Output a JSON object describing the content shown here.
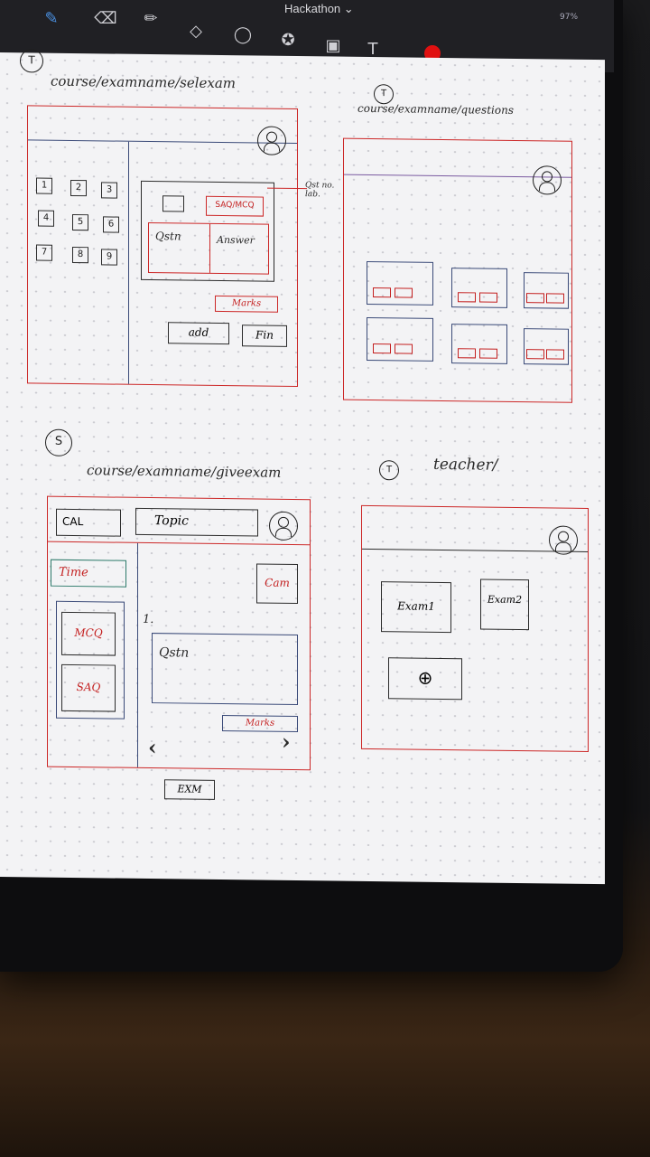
{
  "app": {
    "title": "Hackathon",
    "title_caret": "⌄",
    "status": "97%"
  },
  "toolbar_icons": [
    "pen-icon",
    "eraser-icon",
    "pencil-icon",
    "shapes-icon",
    "lasso-icon",
    "star-icon",
    "image-icon",
    "text-icon",
    "color-red-icon"
  ],
  "sketch1": {
    "badge": "T",
    "path": "course/examname/selexam",
    "numbers": [
      "1",
      "2",
      "3",
      "4",
      "5",
      "6",
      "7",
      "8",
      "9"
    ],
    "type_box": "SAQ/MCQ",
    "question": "Qstn",
    "answer": "Answer",
    "marks": "Marks",
    "add": "add",
    "fin": "Fin",
    "annotation": "Qst no. lab."
  },
  "sketch2": {
    "badge": "T",
    "path": "course/examname/questions"
  },
  "sketch3": {
    "badge": "S",
    "path": "course/examname/giveexam",
    "cal": "CAL",
    "topic": "Topic",
    "time": "Time",
    "cam": "Cam",
    "mcq": "MCQ",
    "saq": "SAQ",
    "qnum": "1.",
    "question": "Qstn",
    "marks": "Marks",
    "prev": "‹",
    "next": "›",
    "exam_button": "EXM"
  },
  "sketch4": {
    "badge": "T",
    "path": "teacher/",
    "exam1": "Exam1",
    "exam2": "Exam2",
    "add": "⊕"
  },
  "colors": {
    "red_ink": "#cc2727",
    "blue_ink": "#3a4a78",
    "paper": "#f3f3f5"
  }
}
